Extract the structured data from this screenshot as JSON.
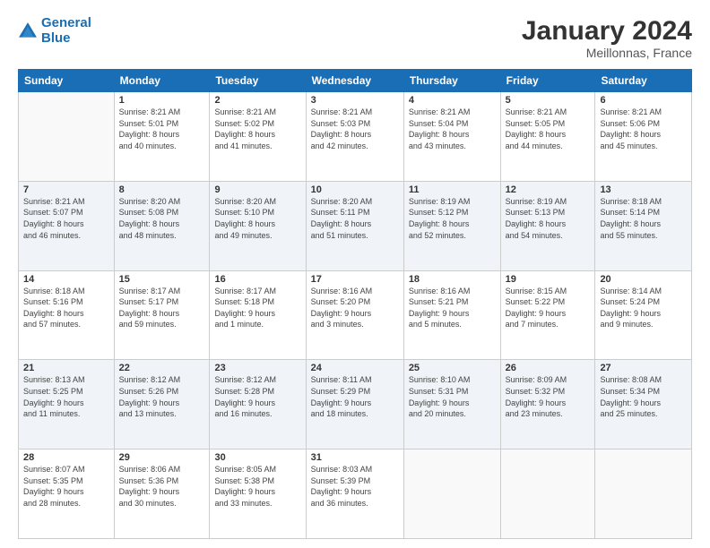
{
  "header": {
    "logo_line1": "General",
    "logo_line2": "Blue",
    "month": "January 2024",
    "location": "Meillonnas, France"
  },
  "weekdays": [
    "Sunday",
    "Monday",
    "Tuesday",
    "Wednesday",
    "Thursday",
    "Friday",
    "Saturday"
  ],
  "weeks": [
    [
      {
        "day": "",
        "info": ""
      },
      {
        "day": "1",
        "info": "Sunrise: 8:21 AM\nSunset: 5:01 PM\nDaylight: 8 hours\nand 40 minutes."
      },
      {
        "day": "2",
        "info": "Sunrise: 8:21 AM\nSunset: 5:02 PM\nDaylight: 8 hours\nand 41 minutes."
      },
      {
        "day": "3",
        "info": "Sunrise: 8:21 AM\nSunset: 5:03 PM\nDaylight: 8 hours\nand 42 minutes."
      },
      {
        "day": "4",
        "info": "Sunrise: 8:21 AM\nSunset: 5:04 PM\nDaylight: 8 hours\nand 43 minutes."
      },
      {
        "day": "5",
        "info": "Sunrise: 8:21 AM\nSunset: 5:05 PM\nDaylight: 8 hours\nand 44 minutes."
      },
      {
        "day": "6",
        "info": "Sunrise: 8:21 AM\nSunset: 5:06 PM\nDaylight: 8 hours\nand 45 minutes."
      }
    ],
    [
      {
        "day": "7",
        "info": "Sunrise: 8:21 AM\nSunset: 5:07 PM\nDaylight: 8 hours\nand 46 minutes."
      },
      {
        "day": "8",
        "info": "Sunrise: 8:20 AM\nSunset: 5:08 PM\nDaylight: 8 hours\nand 48 minutes."
      },
      {
        "day": "9",
        "info": "Sunrise: 8:20 AM\nSunset: 5:10 PM\nDaylight: 8 hours\nand 49 minutes."
      },
      {
        "day": "10",
        "info": "Sunrise: 8:20 AM\nSunset: 5:11 PM\nDaylight: 8 hours\nand 51 minutes."
      },
      {
        "day": "11",
        "info": "Sunrise: 8:19 AM\nSunset: 5:12 PM\nDaylight: 8 hours\nand 52 minutes."
      },
      {
        "day": "12",
        "info": "Sunrise: 8:19 AM\nSunset: 5:13 PM\nDaylight: 8 hours\nand 54 minutes."
      },
      {
        "day": "13",
        "info": "Sunrise: 8:18 AM\nSunset: 5:14 PM\nDaylight: 8 hours\nand 55 minutes."
      }
    ],
    [
      {
        "day": "14",
        "info": "Sunrise: 8:18 AM\nSunset: 5:16 PM\nDaylight: 8 hours\nand 57 minutes."
      },
      {
        "day": "15",
        "info": "Sunrise: 8:17 AM\nSunset: 5:17 PM\nDaylight: 8 hours\nand 59 minutes."
      },
      {
        "day": "16",
        "info": "Sunrise: 8:17 AM\nSunset: 5:18 PM\nDaylight: 9 hours\nand 1 minute."
      },
      {
        "day": "17",
        "info": "Sunrise: 8:16 AM\nSunset: 5:20 PM\nDaylight: 9 hours\nand 3 minutes."
      },
      {
        "day": "18",
        "info": "Sunrise: 8:16 AM\nSunset: 5:21 PM\nDaylight: 9 hours\nand 5 minutes."
      },
      {
        "day": "19",
        "info": "Sunrise: 8:15 AM\nSunset: 5:22 PM\nDaylight: 9 hours\nand 7 minutes."
      },
      {
        "day": "20",
        "info": "Sunrise: 8:14 AM\nSunset: 5:24 PM\nDaylight: 9 hours\nand 9 minutes."
      }
    ],
    [
      {
        "day": "21",
        "info": "Sunrise: 8:13 AM\nSunset: 5:25 PM\nDaylight: 9 hours\nand 11 minutes."
      },
      {
        "day": "22",
        "info": "Sunrise: 8:12 AM\nSunset: 5:26 PM\nDaylight: 9 hours\nand 13 minutes."
      },
      {
        "day": "23",
        "info": "Sunrise: 8:12 AM\nSunset: 5:28 PM\nDaylight: 9 hours\nand 16 minutes."
      },
      {
        "day": "24",
        "info": "Sunrise: 8:11 AM\nSunset: 5:29 PM\nDaylight: 9 hours\nand 18 minutes."
      },
      {
        "day": "25",
        "info": "Sunrise: 8:10 AM\nSunset: 5:31 PM\nDaylight: 9 hours\nand 20 minutes."
      },
      {
        "day": "26",
        "info": "Sunrise: 8:09 AM\nSunset: 5:32 PM\nDaylight: 9 hours\nand 23 minutes."
      },
      {
        "day": "27",
        "info": "Sunrise: 8:08 AM\nSunset: 5:34 PM\nDaylight: 9 hours\nand 25 minutes."
      }
    ],
    [
      {
        "day": "28",
        "info": "Sunrise: 8:07 AM\nSunset: 5:35 PM\nDaylight: 9 hours\nand 28 minutes."
      },
      {
        "day": "29",
        "info": "Sunrise: 8:06 AM\nSunset: 5:36 PM\nDaylight: 9 hours\nand 30 minutes."
      },
      {
        "day": "30",
        "info": "Sunrise: 8:05 AM\nSunset: 5:38 PM\nDaylight: 9 hours\nand 33 minutes."
      },
      {
        "day": "31",
        "info": "Sunrise: 8:03 AM\nSunset: 5:39 PM\nDaylight: 9 hours\nand 36 minutes."
      },
      {
        "day": "",
        "info": ""
      },
      {
        "day": "",
        "info": ""
      },
      {
        "day": "",
        "info": ""
      }
    ]
  ]
}
